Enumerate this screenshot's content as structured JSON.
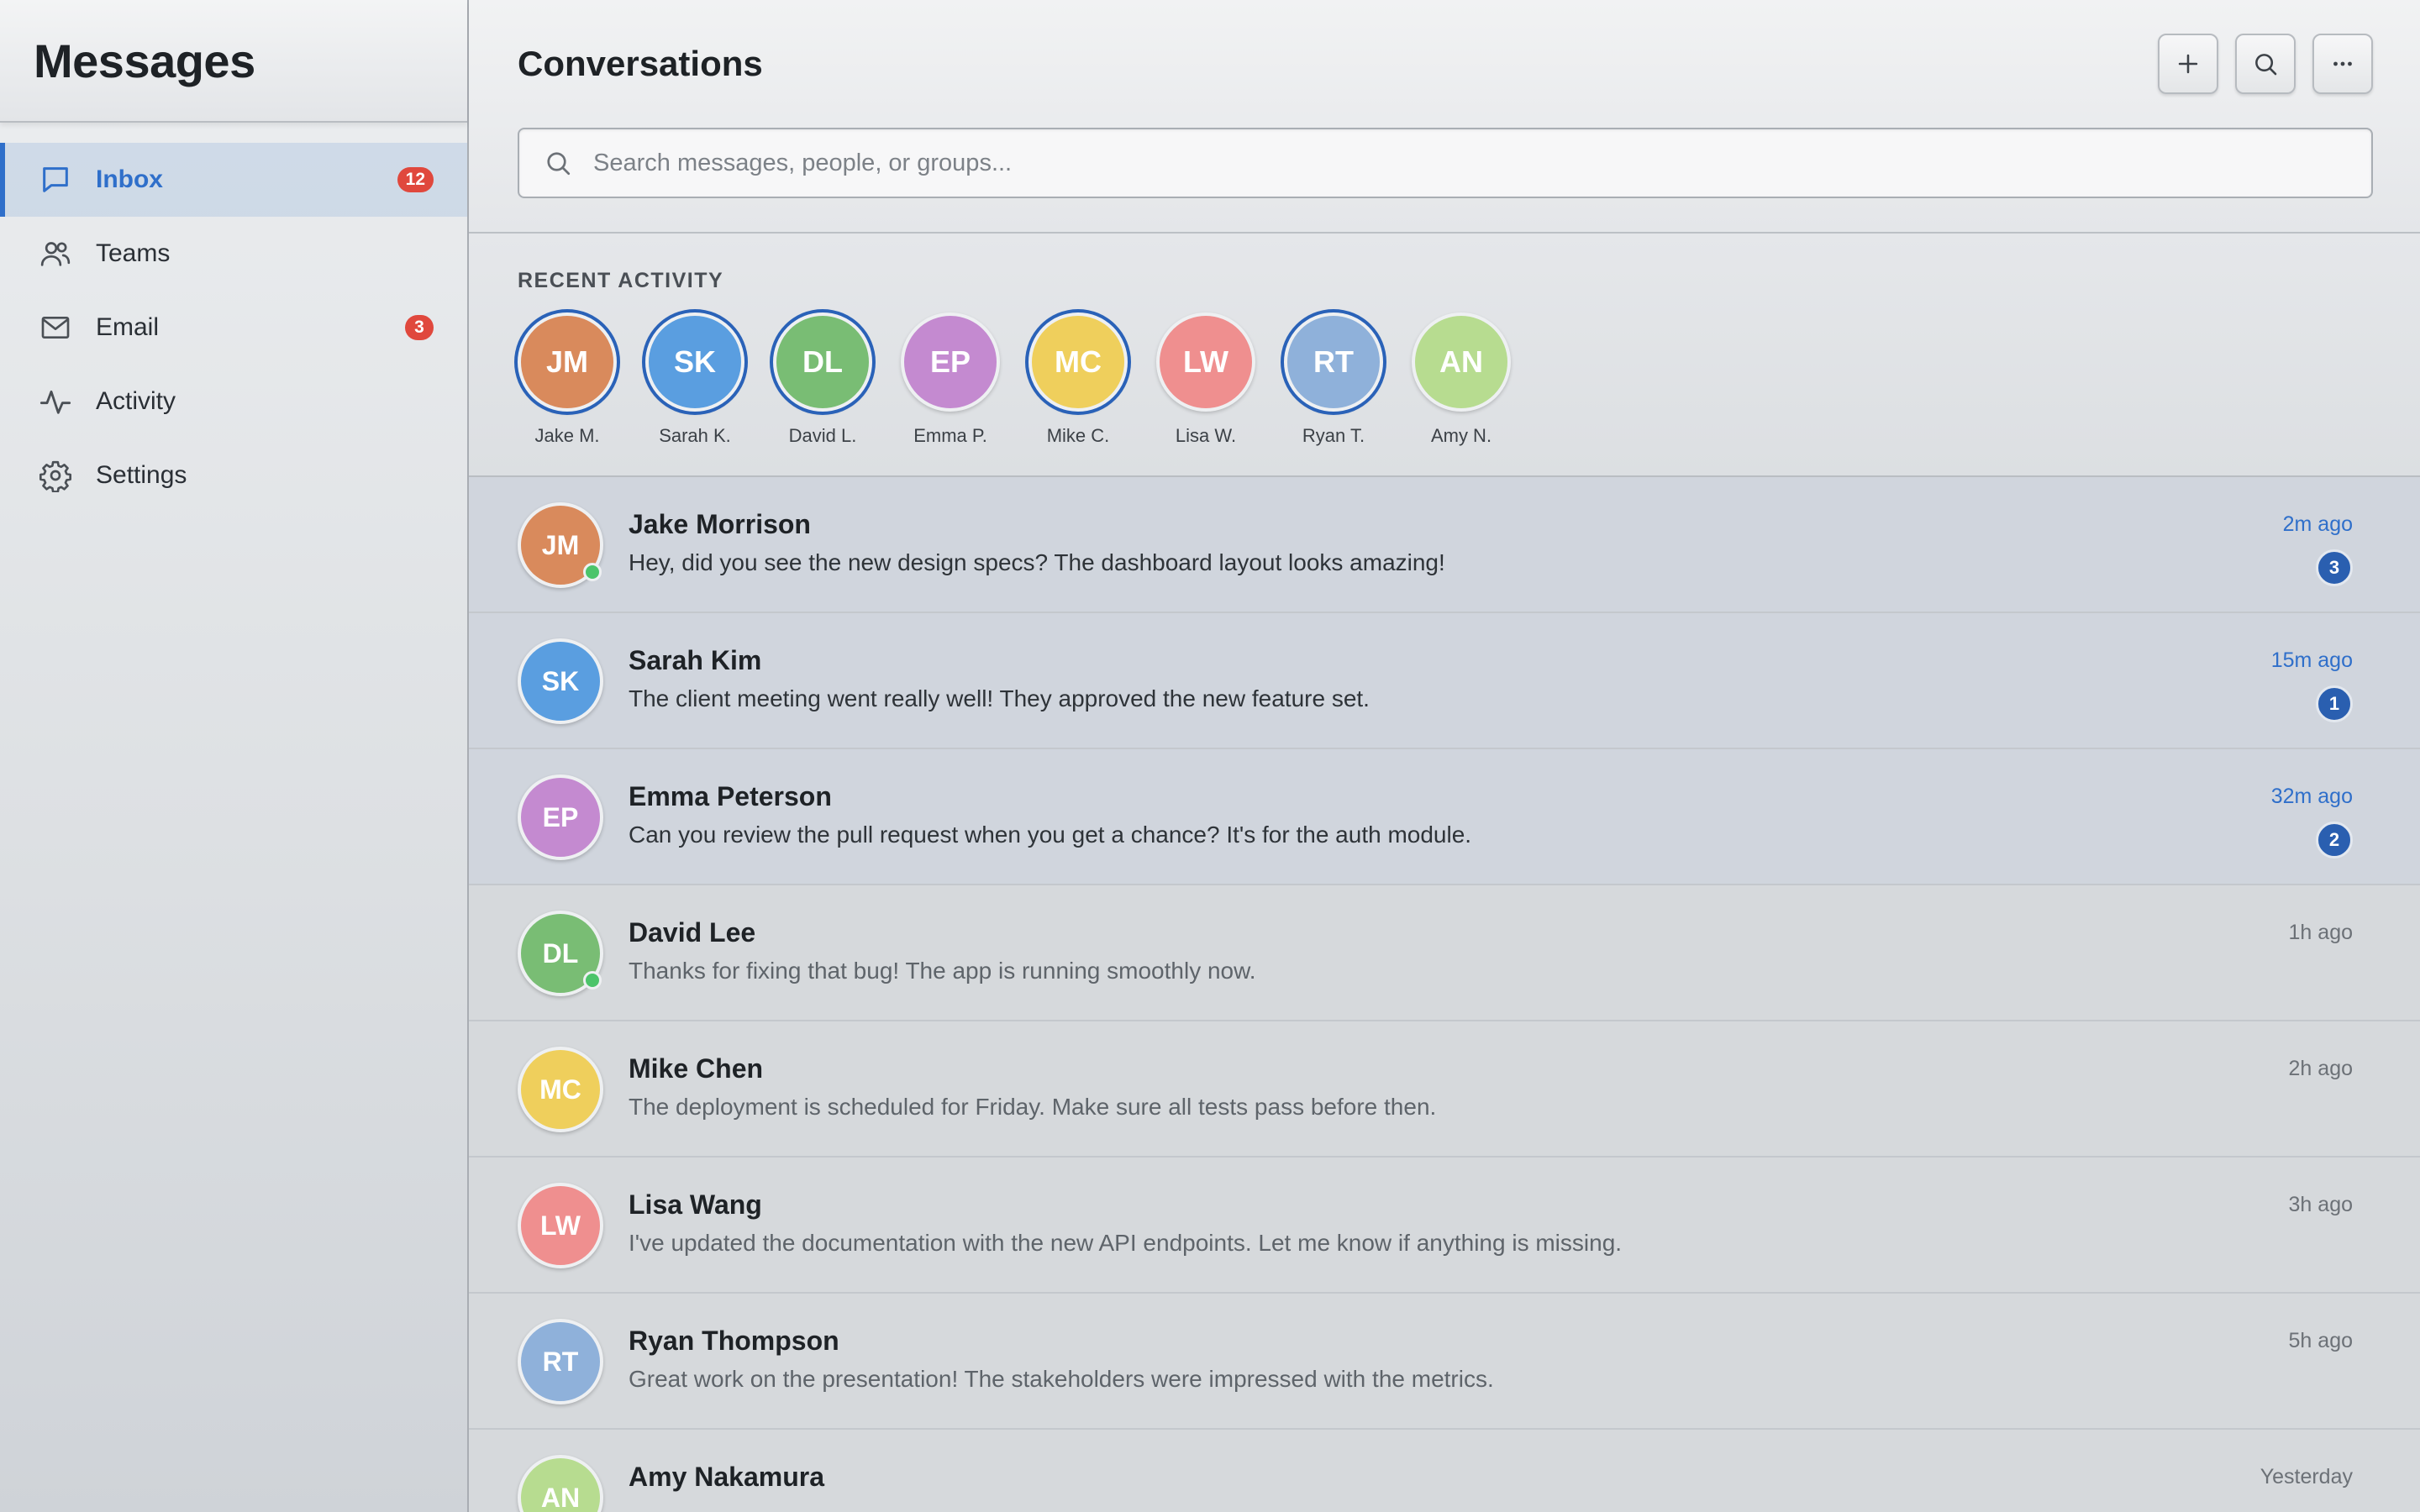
{
  "app": {
    "title": "Messages"
  },
  "sidebar": {
    "items": [
      {
        "label": "Inbox",
        "badge": "12",
        "icon": "chat-bubble-icon"
      },
      {
        "label": "Teams",
        "badge": "",
        "icon": "users-icon"
      },
      {
        "label": "Email",
        "badge": "3",
        "icon": "envelope-icon"
      },
      {
        "label": "Activity",
        "badge": "",
        "icon": "pulse-icon"
      },
      {
        "label": "Settings",
        "badge": "",
        "icon": "gear-icon"
      }
    ]
  },
  "header": {
    "title": "Conversations",
    "actions": [
      "plus-icon",
      "search-icon",
      "more-horizontal-icon"
    ]
  },
  "search": {
    "placeholder": "Search messages, people, or groups...",
    "value": ""
  },
  "recent": {
    "title": "RECENT ACTIVITY",
    "people": [
      {
        "initials": "JM",
        "name": "Jake M.",
        "color": "#d98a5c"
      },
      {
        "initials": "SK",
        "name": "Sarah K.",
        "color": "#5a9ee0"
      },
      {
        "initials": "DL",
        "name": "David L.",
        "color": "#79bd74"
      },
      {
        "initials": "EP",
        "name": "Emma P.",
        "color": "#c48ad0"
      },
      {
        "initials": "MC",
        "name": "Mike C.",
        "color": "#efcf5c"
      },
      {
        "initials": "LW",
        "name": "Lisa W.",
        "color": "#ef8f8f"
      },
      {
        "initials": "RT",
        "name": "Ryan T.",
        "color": "#8fb1da"
      },
      {
        "initials": "AN",
        "name": "Amy N.",
        "color": "#b7dc90"
      }
    ]
  },
  "conversations": [
    {
      "initials": "JM",
      "name": "Jake Morrison",
      "preview": "Hey, did you see the new design specs? The dashboard layout looks amazing!",
      "time": "2m ago",
      "unread": "3",
      "color": "#d98a5c"
    },
    {
      "initials": "SK",
      "name": "Sarah Kim",
      "preview": "The client meeting went really well! They approved the new feature set.",
      "time": "15m ago",
      "unread": "1",
      "color": "#5a9ee0"
    },
    {
      "initials": "EP",
      "name": "Emma Peterson",
      "preview": "Can you review the pull request when you get a chance? It's for the auth module.",
      "time": "32m ago",
      "unread": "2",
      "color": "#c48ad0"
    },
    {
      "initials": "DL",
      "name": "David Lee",
      "preview": "Thanks for fixing that bug! The app is running smoothly now.",
      "time": "1h ago",
      "unread": "",
      "color": "#79bd74"
    },
    {
      "initials": "MC",
      "name": "Mike Chen",
      "preview": "The deployment is scheduled for Friday. Make sure all tests pass before then.",
      "time": "2h ago",
      "unread": "",
      "color": "#efcf5c"
    },
    {
      "initials": "LW",
      "name": "Lisa Wang",
      "preview": "I've updated the documentation with the new API endpoints. Let me know if anything is missing.",
      "time": "3h ago",
      "unread": "",
      "color": "#ef8f8f"
    },
    {
      "initials": "RT",
      "name": "Ryan Thompson",
      "preview": "Great work on the presentation! The stakeholders were impressed with the metrics.",
      "time": "5h ago",
      "unread": "",
      "color": "#8fb1da"
    },
    {
      "initials": "AN",
      "name": "Amy Nakamura",
      "preview": "",
      "time": "Yesterday",
      "unread": "",
      "color": "#b7dc90"
    }
  ],
  "theme": {
    "accent": "#2f6fca",
    "badge_red": "#e0483d",
    "online": "#4cc46a"
  }
}
